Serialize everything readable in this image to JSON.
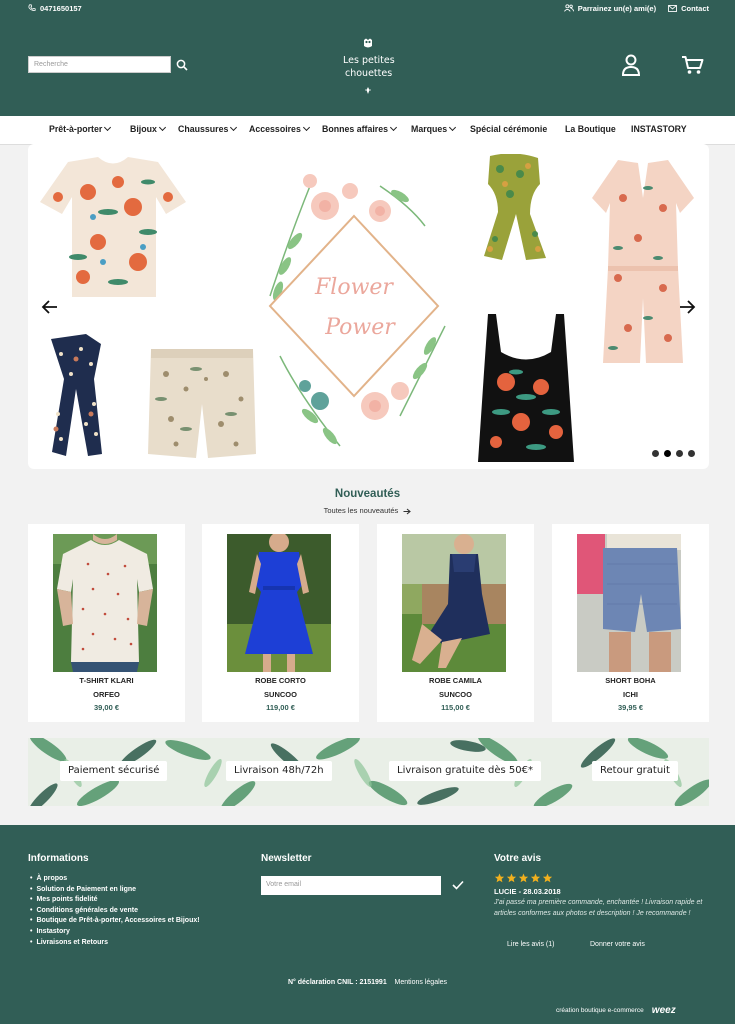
{
  "topbar": {
    "phone": "0471650157",
    "sponsor": "Parrainez un(e) ami(e)",
    "contact": "Contact"
  },
  "header": {
    "search_placeholder": "Recherche",
    "logo_line1": "Les petites",
    "logo_line2": "chouettes"
  },
  "nav": [
    {
      "label": "Prêt-à-porter",
      "dropdown": true
    },
    {
      "label": "Bijoux",
      "dropdown": true
    },
    {
      "label": "Chaussures",
      "dropdown": true
    },
    {
      "label": "Accessoires",
      "dropdown": true
    },
    {
      "label": "Bonnes affaires",
      "dropdown": true
    },
    {
      "label": "Marques",
      "dropdown": true
    },
    {
      "label": "Spécial cérémonie",
      "dropdown": false
    },
    {
      "label": "La Boutique",
      "dropdown": false
    },
    {
      "label": "INSTASTORY",
      "dropdown": false
    }
  ],
  "hero": {
    "title_line1": "Flower",
    "title_line2": "Power",
    "slides_count": 4,
    "active_slide": 2
  },
  "new_products": {
    "title": "Nouveautés",
    "link": "Toutes les nouveautés",
    "items": [
      {
        "name": "T-SHIRT KLARI",
        "brand": "ORFEO",
        "price": "39,00 €"
      },
      {
        "name": "ROBE CORTO",
        "brand": "SUNCOO",
        "price": "119,00 €"
      },
      {
        "name": "ROBE CAMILA",
        "brand": "SUNCOO",
        "price": "115,00 €"
      },
      {
        "name": "SHORT BOHA",
        "brand": "ICHI",
        "price": "39,95 €"
      }
    ]
  },
  "banner": {
    "labels": [
      "Paiement sécurisé",
      "Livraison 48h/72h",
      "Livraison gratuite dès 50€*",
      "Retour gratuit"
    ]
  },
  "footer": {
    "info_title": "Informations",
    "info_links": [
      "À propos",
      "Solution de Paiement en ligne",
      "Mes points fidelité",
      "Conditions générales de vente",
      "Boutique de Prêt-à-porter, Accessoires et Bijoux!",
      "Instastory",
      "Livraisons et Retours"
    ],
    "newsletter_title": "Newsletter",
    "newsletter_placeholder": "Votre email",
    "review_title": "Votre avis",
    "review_rating": 5,
    "review_author": "LUCIE - 28.03.2018",
    "review_text": "J'ai passé ma première commande, enchantée ! Livraison rapide et articles conformes aux photos et description ! Je recommande !",
    "read_reviews": "Lire les avis (1)",
    "give_review": "Donner votre avis",
    "legal_cnil": "N° déclaration CNIL : 2151991",
    "legal_mentions": "Mentions légales",
    "credit": "création boutique e-commerce",
    "credit_brand": "weez"
  },
  "colors": {
    "brand_green": "#315e56",
    "star": "#f2b01e",
    "accent_pink": "#e9a9a0"
  }
}
